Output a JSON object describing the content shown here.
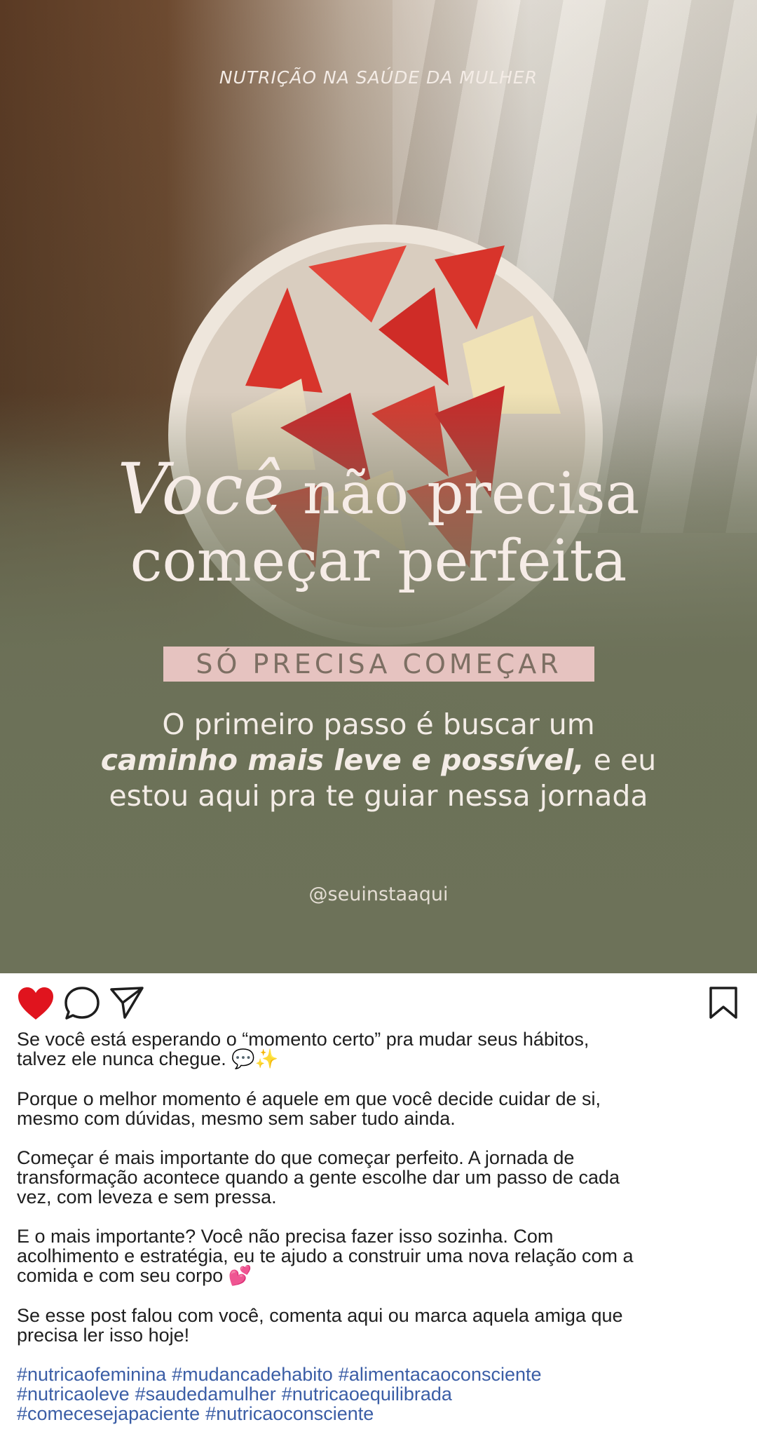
{
  "post": {
    "topic": "NUTRIÇÃO NA SAÚDE DA MULHER",
    "headline_script": "Você",
    "headline_line1_rest": "não precisa",
    "headline_line2": "começar perfeita",
    "banner": "SÓ PRECISA COMEÇAR",
    "sub_line1": "O primeiro passo é buscar um",
    "sub_line2_bold": "caminho mais leve e possível,",
    "sub_line2_rest": " e eu",
    "sub_line3": "estou aqui pra te guiar nessa jornada",
    "handle": "@seuinstaaqui"
  },
  "actions": {
    "like_icon": "heart-icon",
    "comment_icon": "comment-icon",
    "share_icon": "send-icon",
    "save_icon": "bookmark-icon",
    "like_color": "#e0141e"
  },
  "caption": {
    "p1_a": "Se você está esperando o “momento certo” pra mudar seus hábitos,",
    "p1_b": "talvez ele nunca chegue. ",
    "p1_emoji": "💬✨",
    "p2_a": "Porque o melhor momento é aquele em que você decide cuidar de si,",
    "p2_b": "mesmo com dúvidas, mesmo sem saber tudo ainda.",
    "p3_a": "Começar é mais importante do que começar perfeito. A jornada de",
    "p3_b": "transformação acontece quando a gente escolhe dar um passo de cada",
    "p3_c": "vez, com leveza e sem pressa.",
    "p4_a": "E o mais importante? Você não precisa fazer isso sozinha. Com",
    "p4_b": "acolhimento e estratégia, eu te ajudo a construir uma nova relação com a",
    "p4_c": "comida e com seu corpo ",
    "p4_emoji": "💕",
    "p5_a": "Se esse post falou com você, comenta aqui ou marca aquela amiga que",
    "p5_b": "precisa ler isso hoje!",
    "hashtags": [
      "#nutricaofeminina",
      "#mudancadehabito",
      "#alimentacaoconsciente",
      "#nutricaoleve",
      "#saudedamulher",
      "#nutricaoequilibrada",
      "#comecesejapaciente",
      "#nutricaoconsciente"
    ]
  }
}
